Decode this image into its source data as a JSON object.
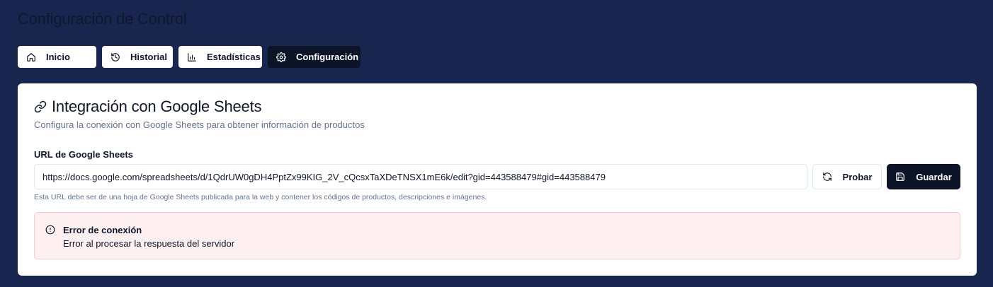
{
  "page": {
    "title": "Configuración de Control"
  },
  "tabs": [
    {
      "label": "Inicio",
      "icon": "home-icon"
    },
    {
      "label": "Historial",
      "icon": "history-icon"
    },
    {
      "label": "Estadísticas",
      "icon": "bar-chart-icon"
    },
    {
      "label": "Configuración",
      "icon": "gear-icon",
      "active": true
    }
  ],
  "card": {
    "title": "Integración con Google Sheets",
    "title_icon": "link-icon",
    "description": "Configura la conexión con Google Sheets para obtener información de productos",
    "url_label": "URL de Google Sheets",
    "url_value": "https://docs.google.com/spreadsheets/d/1QdrUW0gDH4PptZx99KIG_2V_cQcsxTaXDeTNSX1mE6k/edit?gid=443588479#gid=443588479",
    "helper_text": "Esta URL debe ser de una hoja de Google Sheets publicada para la web y contener los códigos de productos, descripciones e imágenes.",
    "buttons": {
      "test_label": "Probar",
      "test_icon": "refresh-icon",
      "save_label": "Guardar",
      "save_icon": "save-icon"
    }
  },
  "alert": {
    "icon": "alert-circle-icon",
    "title": "Error de conexión",
    "message": "Error al procesar la respuesta del servidor"
  },
  "colors": {
    "background": "#18254f",
    "active_tab": "#0c1428",
    "primary_button": "#0c1428",
    "alert_bg": "#fef0f0",
    "alert_border": "#fecaca"
  }
}
